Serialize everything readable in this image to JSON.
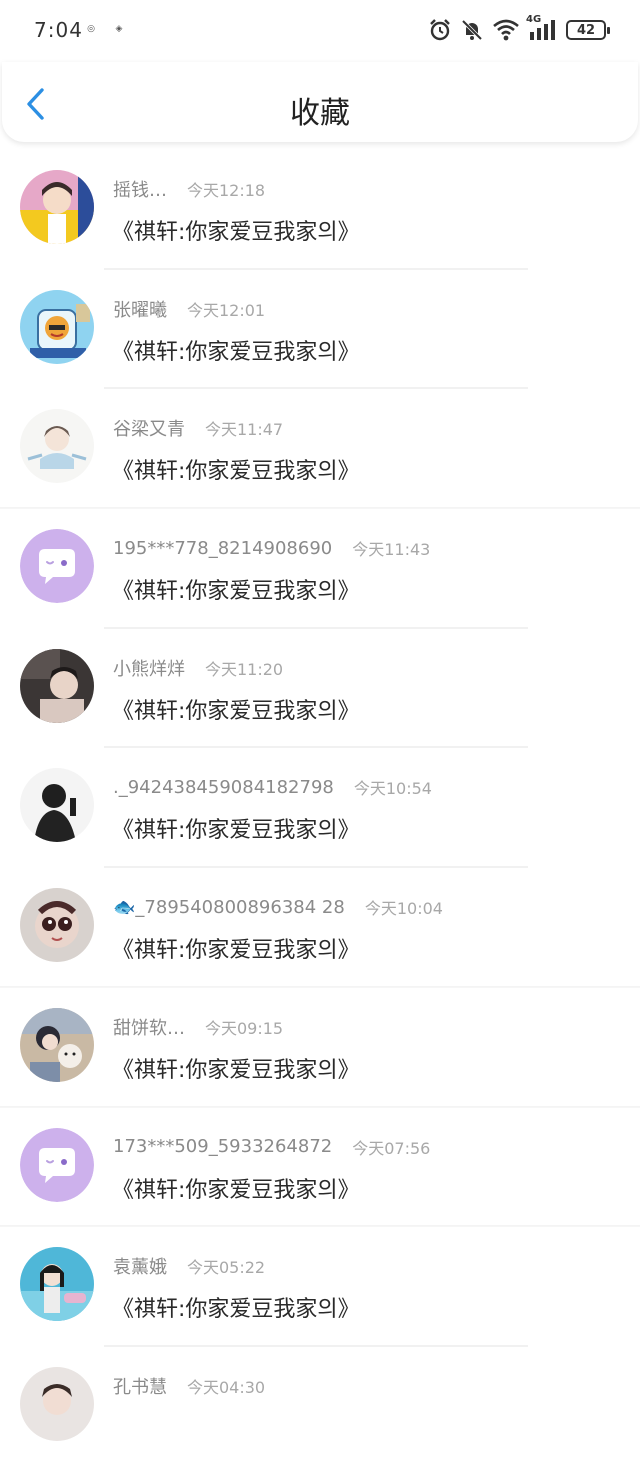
{
  "status_bar": {
    "time": "7:04",
    "battery": "42",
    "network": "4G",
    "icons": [
      "alarm-icon",
      "mute-bell-icon",
      "wifi-icon",
      "signal-icon",
      "battery-icon"
    ]
  },
  "header": {
    "title": "收藏",
    "back_icon": "chevron-left-icon"
  },
  "colors": {
    "accent": "#2c8fe3",
    "default_avatar": "#cdb1ec"
  },
  "list": [
    {
      "name": "摇钱…",
      "time": "今天12:18",
      "message": "《祺轩:你家爱豆我家의》",
      "avatar": "photo"
    },
    {
      "name": "张曜曦",
      "time": "今天12:01",
      "message": "《祺轩:你家爱豆我家의》",
      "avatar": "photo"
    },
    {
      "name": "谷梁又青",
      "time": "今天11:47",
      "message": "《祺轩:你家爱豆我家의》",
      "avatar": "photo"
    },
    {
      "name": "195***778_8214908690",
      "time": "今天11:43",
      "message": "《祺轩:你家爱豆我家의》",
      "avatar": "default"
    },
    {
      "name": "小熊烊烊",
      "time": "今天11:20",
      "message": "《祺轩:你家爱豆我家의》",
      "avatar": "photo"
    },
    {
      "name": "._942438459084182798",
      "time": "今天10:54",
      "message": "《祺轩:你家爱豆我家의》",
      "avatar": "photo"
    },
    {
      "name": "🐟_789540800896384 28",
      "time": "今天10:04",
      "message": "《祺轩:你家爱豆我家의》",
      "avatar": "photo"
    },
    {
      "name": "甜饼软…",
      "time": "今天09:15",
      "message": "《祺轩:你家爱豆我家의》",
      "avatar": "photo"
    },
    {
      "name": "173***509_5933264872",
      "time": "今天07:56",
      "message": "《祺轩:你家爱豆我家의》",
      "avatar": "default"
    },
    {
      "name": "袁薰娥",
      "time": "今天05:22",
      "message": "《祺轩:你家爱豆我家의》",
      "avatar": "photo"
    },
    {
      "name": "孔书慧",
      "time": "今天04:30",
      "message": "",
      "avatar": "photo"
    }
  ]
}
